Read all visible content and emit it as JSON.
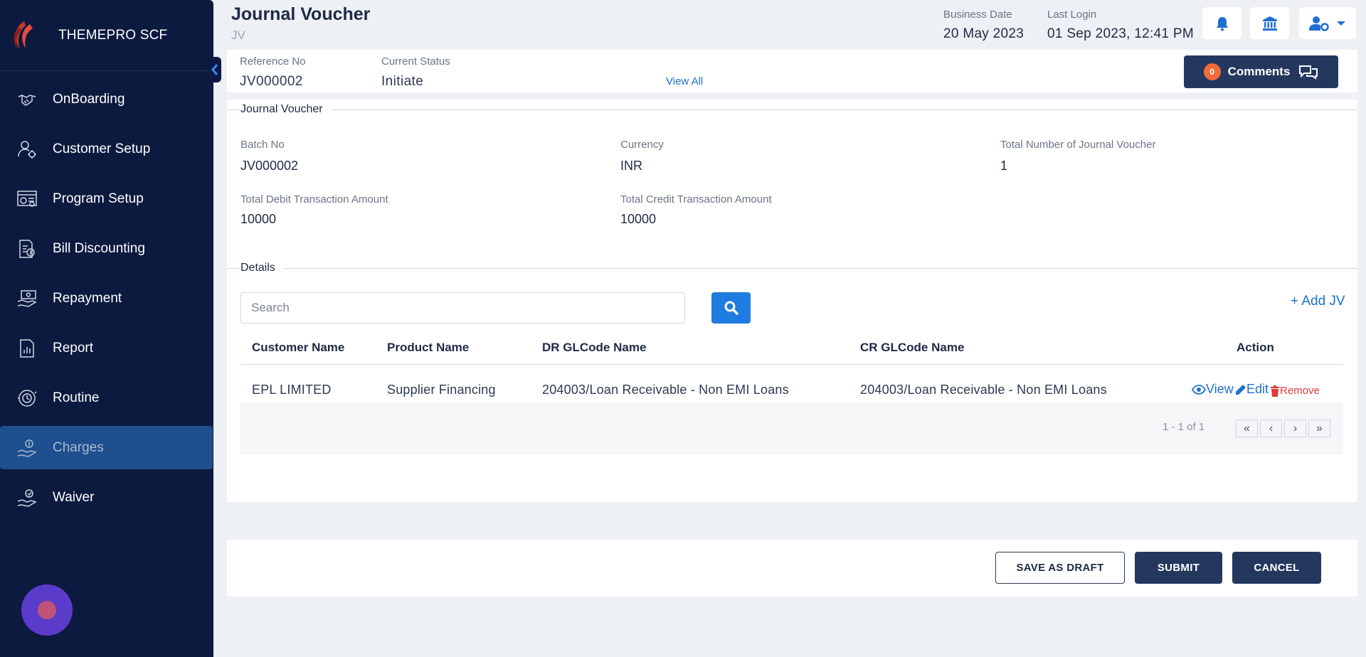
{
  "sidebar": {
    "brand": "THEMEPRO SCF",
    "items": [
      {
        "label": "OnBoarding",
        "icon": "handshake-icon"
      },
      {
        "label": "Customer Setup",
        "icon": "user-gear-icon"
      },
      {
        "label": "Program Setup",
        "icon": "dashboard-icon"
      },
      {
        "label": "Bill Discounting",
        "icon": "bill-icon"
      },
      {
        "label": "Repayment",
        "icon": "money-hand-icon"
      },
      {
        "label": "Report",
        "icon": "report-icon"
      },
      {
        "label": "Routine",
        "icon": "routine-icon"
      },
      {
        "label": "Charges",
        "icon": "charges-hand-icon",
        "active": true
      },
      {
        "label": "Waiver",
        "icon": "waiver-hand-icon"
      }
    ]
  },
  "header": {
    "title": "Journal Voucher",
    "subtitle": "JV",
    "business_date_label": "Business Date",
    "business_date": "20 May 2023",
    "last_login_label": "Last Login",
    "last_login": "01 Sep 2023, 12:41 PM"
  },
  "refbar": {
    "reference_label": "Reference No",
    "reference_value": "JV000002",
    "status_label": "Current Status",
    "status_value": "Initiate",
    "view_all": "View All",
    "comments_count": "0",
    "comments_label": "Comments"
  },
  "voucher": {
    "section_title": "Journal Voucher",
    "batch_label": "Batch No",
    "batch_value": "JV000002",
    "currency_label": "Currency",
    "currency_value": "INR",
    "total_jv_label": "Total Number of Journal Voucher",
    "total_jv_value": "1",
    "total_debit_label": "Total Debit Transaction Amount",
    "total_debit_value": "10000",
    "total_credit_label": "Total Credit Transaction Amount",
    "total_credit_value": "10000"
  },
  "details": {
    "section_title": "Details",
    "search_placeholder": "Search",
    "add_jv": "+ Add JV",
    "columns": [
      "Customer Name",
      "Product Name",
      "DR GLCode Name",
      "CR GLCode Name",
      "Action"
    ],
    "rows": [
      {
        "customer": "EPL LIMITED",
        "product": "Supplier Financing",
        "dr": "204003/Loan Receivable - Non EMI Loans",
        "cr": "204003/Loan Receivable - Non EMI Loans",
        "view": "View",
        "edit": "Edit",
        "remove": "Remove"
      }
    ],
    "pager_info": "1 - 1 of 1",
    "pager_first": "«",
    "pager_prev": "‹",
    "pager_next": "›",
    "pager_last": "»"
  },
  "footer": {
    "save_draft": "SAVE AS DRAFT",
    "submit": "SUBMIT",
    "cancel": "CANCEL"
  },
  "colors": {
    "sidebar_bg": "#0d1a3f",
    "active_bg": "#1e4f8f",
    "primary_btn": "#24385e",
    "link_blue": "#1f6fd1",
    "search_btn": "#1e7be0",
    "remove_red": "#e03a3a",
    "badge_orange": "#f26a3a"
  }
}
